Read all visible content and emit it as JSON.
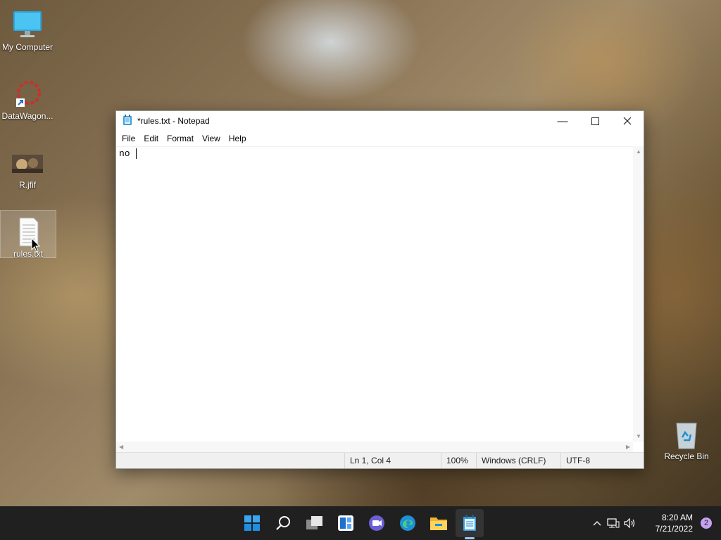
{
  "desktop": {
    "icons": [
      {
        "label": "My Computer"
      },
      {
        "label": "DataWagon..."
      },
      {
        "label": "R.jfif"
      },
      {
        "label": "rules.txt"
      }
    ],
    "recycle_bin": {
      "label": "Recycle Bin"
    }
  },
  "notepad": {
    "title": "*rules.txt - Notepad",
    "menu": [
      "File",
      "Edit",
      "Format",
      "View",
      "Help"
    ],
    "content": "no ",
    "status": {
      "position": "Ln 1, Col 4",
      "zoom": "100%",
      "line_ending": "Windows (CRLF)",
      "encoding": "UTF-8"
    }
  },
  "taskbar": {
    "icons": [
      "start-icon",
      "search-icon",
      "task-view-icon",
      "widgets-icon",
      "teams-chat-icon",
      "edge-icon",
      "file-explorer-icon",
      "notepad-icon"
    ],
    "clock": {
      "time": "8:20 AM",
      "date": "7/21/2022"
    },
    "notification_count": "2"
  },
  "colors": {
    "taskbar": "#202020",
    "accent": "#0078d4"
  }
}
